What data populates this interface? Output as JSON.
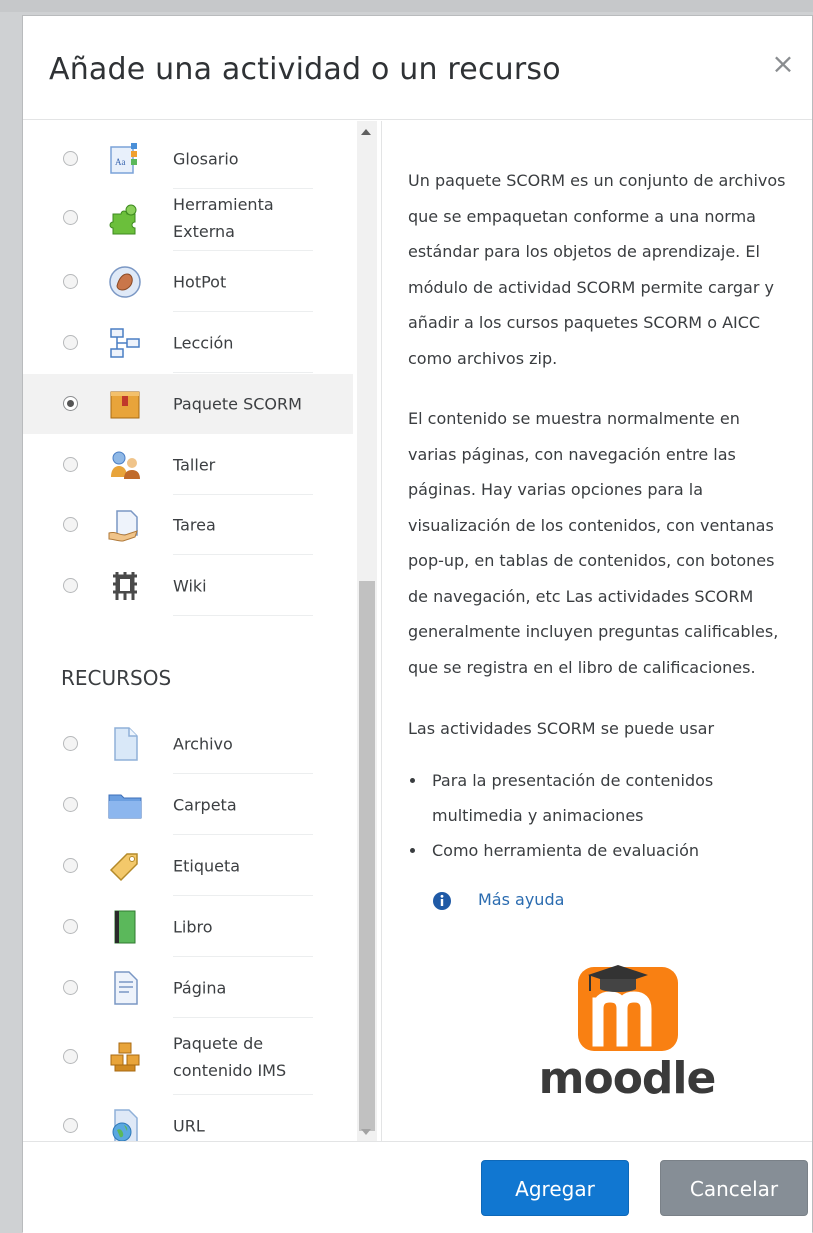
{
  "dialog": {
    "title": "Añade una actividad o un recurso",
    "close_glyph": "×"
  },
  "activities": [
    {
      "label": "Glosario",
      "icon": "glossary-icon",
      "selected": false
    },
    {
      "label": "Herramienta Externa",
      "icon": "puzzle-icon",
      "selected": false
    },
    {
      "label": "HotPot",
      "icon": "hotpot-icon",
      "selected": false
    },
    {
      "label": "Lección",
      "icon": "lesson-icon",
      "selected": false
    },
    {
      "label": "Paquete SCORM",
      "icon": "scorm-package-icon",
      "selected": true
    },
    {
      "label": "Taller",
      "icon": "workshop-icon",
      "selected": false
    },
    {
      "label": "Tarea",
      "icon": "assignment-icon",
      "selected": false
    },
    {
      "label": "Wiki",
      "icon": "wiki-icon",
      "selected": false
    }
  ],
  "resources_heading": "RECURSOS",
  "resources": [
    {
      "label": "Archivo",
      "icon": "file-icon",
      "selected": false
    },
    {
      "label": "Carpeta",
      "icon": "folder-icon",
      "selected": false
    },
    {
      "label": "Etiqueta",
      "icon": "label-tag-icon",
      "selected": false
    },
    {
      "label": "Libro",
      "icon": "book-icon",
      "selected": false
    },
    {
      "label": "Página",
      "icon": "page-icon",
      "selected": false
    },
    {
      "label": "Paquete de contenido IMS",
      "icon": "ims-package-icon",
      "selected": false
    },
    {
      "label": "URL",
      "icon": "url-globe-icon",
      "selected": false
    }
  ],
  "description": {
    "paragraph_1": "Un paquete SCORM es un conjunto de archivos que se empaquetan conforme a una norma estándar para los objetos de aprendizaje. El módulo de actividad SCORM permite cargar y añadir a los cursos paquetes SCORM o AICC como archivos zip.",
    "paragraph_2": "El contenido se muestra normalmente en varias páginas, con navegación entre las páginas. Hay varias opciones para la visualización de los contenidos, con ventanas pop-up, en tablas de contenidos, con botones de navegación, etc Las actividades SCORM generalmente incluyen preguntas calificables, que se registra en el libro de calificaciones.",
    "paragraph_3": "Las actividades SCORM se puede usar",
    "bullets": [
      "Para la presentación de contenidos multimedia y animaciones",
      "Como herramienta de evaluación"
    ],
    "help_link": "Más ayuda"
  },
  "logo": {
    "text": "moodle",
    "brand_color": "#f98012"
  },
  "footer": {
    "add_button": "Agregar",
    "cancel_button": "Cancelar",
    "primary_color": "#1177d1",
    "secondary_color": "#868e96"
  }
}
